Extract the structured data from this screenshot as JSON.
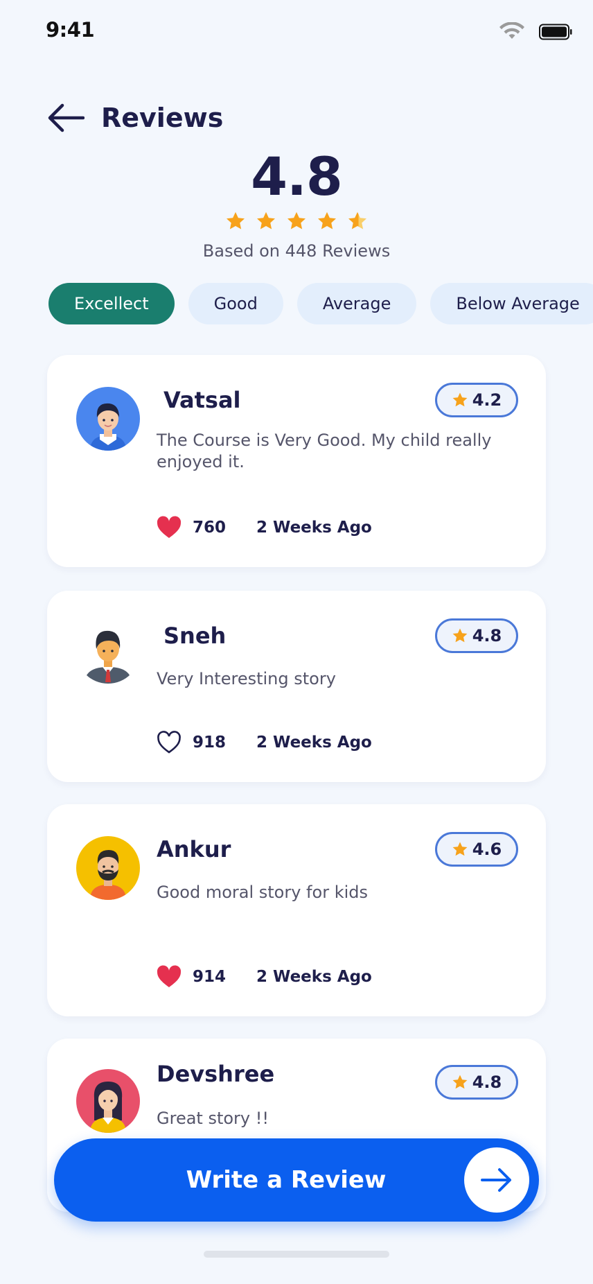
{
  "status_bar": {
    "time": "9:41"
  },
  "header": {
    "title": "Reviews"
  },
  "summary": {
    "rating": "4.8",
    "stars": 4.5,
    "based_on": "Based on 448 Reviews"
  },
  "filters": [
    "Excellect",
    "Good",
    "Average",
    "Below Average"
  ],
  "active_filter": "Excellect",
  "reviews": [
    {
      "name": "Vatsal",
      "rating": "4.2",
      "text": "The Course is Very Good. My child really enjoyed it.",
      "likes": "760",
      "liked": true,
      "ago": "2 Weeks Ago",
      "avatar_bg": "#4a86ee"
    },
    {
      "name": "Sneh",
      "rating": "4.8",
      "text": "Very Interesting story",
      "likes": "918",
      "liked": false,
      "ago": "2 Weeks Ago",
      "avatar_bg": "#ffffff"
    },
    {
      "name": "Ankur",
      "rating": "4.6",
      "text": "Good moral story for kids",
      "likes": "914",
      "liked": true,
      "ago": "2 Weeks Ago",
      "avatar_bg": "#f5c000"
    },
    {
      "name": "Devshree",
      "rating": "4.8",
      "text": "Great story !!",
      "avatar_bg": "#e8506a"
    }
  ],
  "cta": {
    "label": "Write a Review"
  },
  "colors": {
    "primary": "#0b5fef",
    "chip_active": "#1a7e6e",
    "chip_inactive": "#e3eefc",
    "star": "#f7a21b",
    "heart": "#e5304f",
    "badge_border": "#4a78d8"
  }
}
